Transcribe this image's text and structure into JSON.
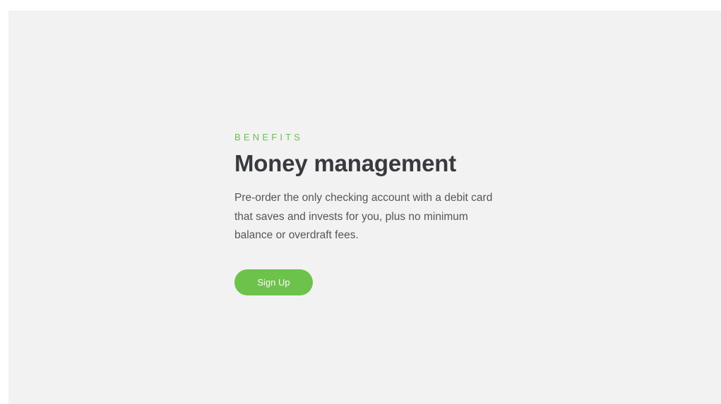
{
  "section": {
    "eyebrow": "BENEFITS",
    "headline": "Money management",
    "description": "Pre-order the only checking account with a debit card that saves and invests for you, plus no minimum balance or overdraft fees.",
    "cta_label": "Sign Up"
  },
  "colors": {
    "accent": "#6cc24a",
    "heading": "#393a40",
    "body": "#55565c",
    "panel_background": "#f2f2f2"
  }
}
